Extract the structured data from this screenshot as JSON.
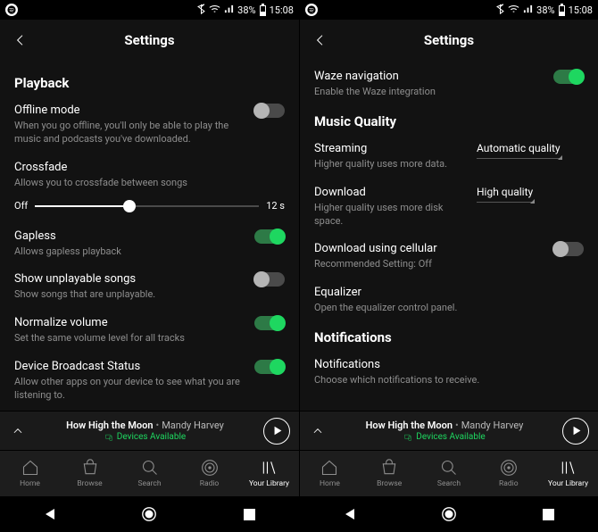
{
  "status": {
    "battery": "38%",
    "time": "15:08"
  },
  "header": {
    "title": "Settings"
  },
  "left": {
    "section": "Playback",
    "offline": {
      "title": "Offline mode",
      "sub": "When you go offline, you'll only be able to play the music and podcasts you've downloaded.",
      "on": false
    },
    "crossfade": {
      "title": "Crossfade",
      "sub": "Allows you to crossfade between songs",
      "min": "Off",
      "max": "12 s",
      "pct": 42
    },
    "gapless": {
      "title": "Gapless",
      "sub": "Allows gapless playback",
      "on": true
    },
    "unplayable": {
      "title": "Show unplayable songs",
      "sub": "Show songs that are unplayable.",
      "on": false
    },
    "normalize": {
      "title": "Normalize volume",
      "sub": "Set the same volume level for all tracks",
      "on": true
    },
    "broadcast": {
      "title": "Device Broadcast Status",
      "sub": "Allow other apps on your device to see what you are listening to.",
      "on": true
    }
  },
  "right": {
    "waze": {
      "title": "Waze navigation",
      "sub": "Enable the Waze integration",
      "on": true
    },
    "section_mq": "Music Quality",
    "streaming": {
      "title": "Streaming",
      "sub": "Higher quality uses more data.",
      "value": "Automatic quality"
    },
    "download": {
      "title": "Download",
      "sub": "Higher quality uses more disk space.",
      "value": "High quality"
    },
    "cellular": {
      "title": "Download using cellular",
      "sub": "Recommended Setting: Off",
      "on": false
    },
    "equalizer": {
      "title": "Equalizer",
      "sub": "Open the equalizer control panel."
    },
    "section_notif": "Notifications",
    "notif": {
      "title": "Notifications",
      "sub": "Choose which notifications to receive."
    }
  },
  "now_playing": {
    "song": "How High the Moon",
    "artist": "Mandy Harvey",
    "devices": "Devices Available"
  },
  "tabs": {
    "home": "Home",
    "browse": "Browse",
    "search": "Search",
    "radio": "Radio",
    "library": "Your Library"
  }
}
